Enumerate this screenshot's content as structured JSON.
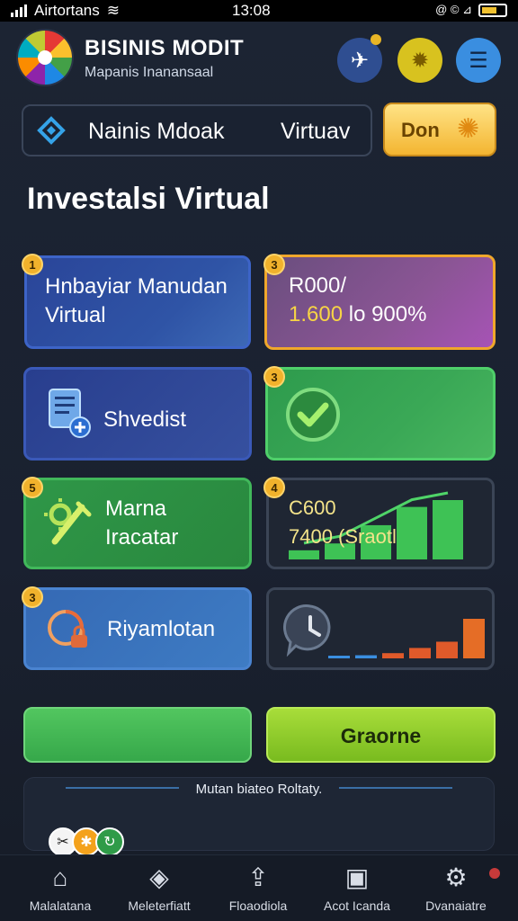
{
  "status_bar": {
    "carrier": "Airtortans",
    "time": "13:08",
    "right_text": "@ © ⊿"
  },
  "header": {
    "title": "BISINIS MODIT",
    "subtitle": "Mapanis Inanansaal"
  },
  "search": {
    "label": "Nainis Mdoak",
    "suffix": "Virtuav"
  },
  "cta": {
    "label": "Don"
  },
  "section_title": "Investalsi Virtual",
  "cards": [
    {
      "badge": "1",
      "line1": "Hnbayiar Manudan",
      "line2": "Virtual"
    },
    {
      "badge": "3",
      "line1": "R000/",
      "line2_accent": "1.600",
      "line2_rest": " lo 900%"
    },
    {
      "badge": "3",
      "label": "Shvedist"
    },
    {
      "badge": "3"
    },
    {
      "badge": "5",
      "line1": "Marna",
      "line2": "Iracatar"
    },
    {
      "badge": "4",
      "line1": "C600",
      "line2": "7400 (Sraotl"
    },
    {
      "badge": "3",
      "label": "Riyamlotan"
    },
    {}
  ],
  "chart_data": [
    {
      "type": "bar",
      "categories": [
        "1",
        "2",
        "3",
        "4",
        "5"
      ],
      "values": [
        8,
        14,
        30,
        46,
        52
      ],
      "color": "#3ec255"
    },
    {
      "type": "bar",
      "categories": [
        "1",
        "2",
        "3",
        "4",
        "5",
        "6"
      ],
      "values": [
        2,
        3,
        5,
        10,
        16,
        38
      ],
      "colors": [
        "#3a8ee0",
        "#3a8ee0",
        "#e05a2a",
        "#e05a2a",
        "#e05a2a",
        "#e56d26"
      ]
    }
  ],
  "buttons": {
    "secondary": "Graorne"
  },
  "footer_panel": {
    "text": "Mutan biateo Roltaty."
  },
  "bottom_nav": [
    {
      "label": "Malalatana"
    },
    {
      "label": "Meleterfiatt"
    },
    {
      "label": "Floaodiola"
    },
    {
      "label": "Acot Icanda"
    },
    {
      "label": "Dvanaiatre"
    }
  ],
  "colors": {
    "background": "#1b2231",
    "accent_blue": "#2f54a6",
    "accent_green": "#3aa856",
    "accent_yellow": "#f1b22c"
  }
}
